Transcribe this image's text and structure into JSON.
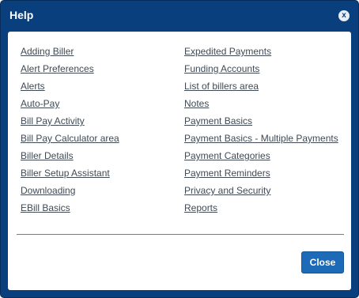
{
  "dialog": {
    "title": "Help",
    "close_icon_glyph": "x",
    "close_button_label": "Close"
  },
  "links": {
    "left": [
      "Adding Biller",
      "Alert Preferences",
      "Alerts",
      "Auto-Pay",
      "Bill Pay Activity",
      "Bill Pay Calculator area",
      "Biller Details",
      "Biller Setup Assistant",
      "Downloading",
      "EBill Basics"
    ],
    "right": [
      "Expedited Payments",
      "Funding Accounts",
      "List of billers area",
      "Notes",
      "Payment Basics",
      "Payment Basics - Multiple Payments",
      "Payment Categories",
      "Payment Reminders",
      "Privacy and Security",
      "Reports"
    ]
  },
  "colors": {
    "frame": "#0a3f7e",
    "button": "#1d6ab8",
    "link": "#3f4a55"
  }
}
